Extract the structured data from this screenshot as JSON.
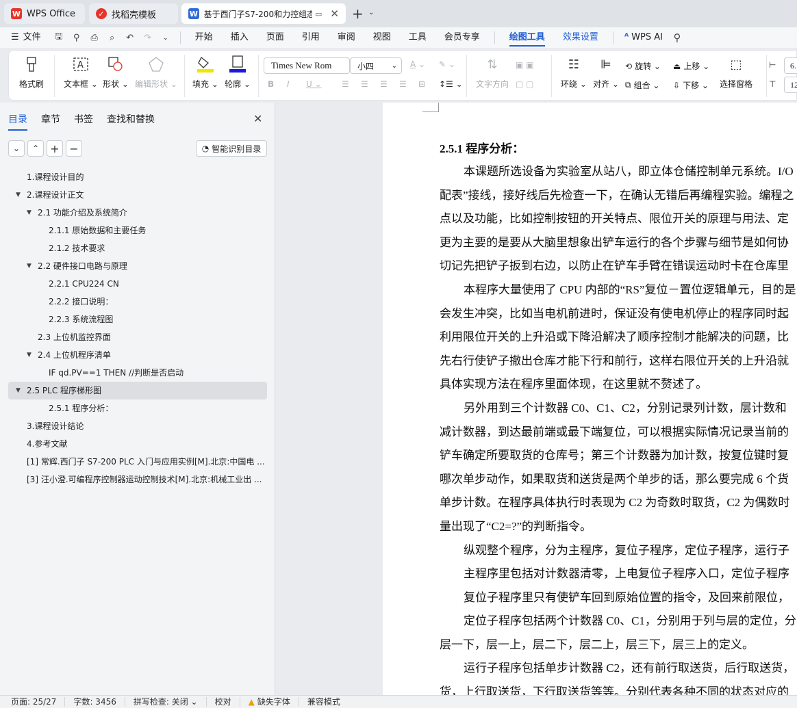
{
  "tabs": [
    {
      "label": "WPS Office"
    },
    {
      "label": "找稻壳模板"
    },
    {
      "label": "基于西门子S7-200和力控组态"
    }
  ],
  "menu": {
    "file": "文件",
    "items": [
      "开始",
      "插入",
      "页面",
      "引用",
      "审阅",
      "视图",
      "工具",
      "会员专享"
    ],
    "drawing_tools": "绘图工具",
    "effect_settings": "效果设置",
    "wps_ai": "WPS AI"
  },
  "ribbon": {
    "format_painter": "格式刷",
    "textbox": "文本框",
    "shape": "形状",
    "edit_shape": "编辑形状",
    "fill": "填充",
    "outline": "轮廓",
    "font_name": "Times New Rom",
    "font_size": "小四",
    "text_direction": "文字方向",
    "wrap": "环绕",
    "align": "对齐",
    "rotate": "旋转",
    "group": "组合",
    "bring_forward": "上移",
    "send_backward": "下移",
    "selection_pane": "选择窗格",
    "width_value": "6.",
    "height_value": "12"
  },
  "nav": {
    "tabs": [
      "目录",
      "章节",
      "书签",
      "查找和替换"
    ],
    "smart_toc": "智能识别目录",
    "toc": [
      {
        "text": "1.课程设计目的",
        "level": 1,
        "arrow": ""
      },
      {
        "text": "2.课程设计正文",
        "level": 1,
        "arrow": "▼"
      },
      {
        "text": "2.1 功能介绍及系统简介",
        "level": 2,
        "arrow": "▼"
      },
      {
        "text": "2.1.1 原始数据和主要任务",
        "level": 3,
        "arrow": ""
      },
      {
        "text": "2.1.2 技术要求",
        "level": 3,
        "arrow": ""
      },
      {
        "text": "2.2 硬件接口电路与原理",
        "level": 2,
        "arrow": "▼"
      },
      {
        "text": "2.2.1 CPU224 CN",
        "level": 3,
        "arrow": ""
      },
      {
        "text": "2.2.2 接口说明：",
        "level": 3,
        "arrow": ""
      },
      {
        "text": "2.2.3 系统流程图",
        "level": 3,
        "arrow": ""
      },
      {
        "text": "2.3 上位机监控界面",
        "level": 2,
        "arrow": ""
      },
      {
        "text": "2.4 上位机程序清单",
        "level": 2,
        "arrow": "▼"
      },
      {
        "text": "IF qd.PV==1 THEN          //判断是否启动",
        "level": 3,
        "arrow": ""
      },
      {
        "text": "2.5 PLC 程序梯形图",
        "level": 1,
        "arrow": "▼",
        "highlight": true
      },
      {
        "text": "2.5.1 程序分析：",
        "level": 3,
        "arrow": ""
      },
      {
        "text": "3.课程设计结论",
        "level": 1,
        "arrow": ""
      },
      {
        "text": "4.参考文献",
        "level": 1,
        "arrow": ""
      },
      {
        "text": "[1]  常辉.西门子 S7-200 PLC 入门与应用实例[M].北京:中国电 ...",
        "level": 1,
        "arrow": ""
      },
      {
        "text": "[3]  汪小澄.可编程序控制器运动控制技术[M].北京:机械工业出 ...",
        "level": 1,
        "arrow": ""
      }
    ]
  },
  "document": {
    "heading": "2.5.1 程序分析：",
    "lines": [
      {
        "text": "本课题所选设备为实验室从站八，即立体仓储控制单元系统。I/O",
        "indent": true
      },
      {
        "text": "配表”接线，接好线后先检查一下，在确认无错后再编程实验。编程之",
        "indent": false
      },
      {
        "text": "点以及功能，比如控制按钮的开关特点、限位开关的原理与用法、定",
        "indent": false
      },
      {
        "text": "更为主要的是要从大脑里想象出铲车运行的各个步骤与细节是如何协",
        "indent": false
      },
      {
        "text": "切记先把铲子扳到右边，以防止在铲车手臂在错误运动时卡在仓库里",
        "indent": false
      },
      {
        "text": "本程序大量使用了 CPU 内部的“RS”复位－置位逻辑单元，目的是",
        "indent": true
      },
      {
        "text": "会发生冲突，比如当电机前进时，保证没有使电机停止的程序同时起",
        "indent": false
      },
      {
        "text": "利用限位开关的上升沿或下降沿解决了顺序控制才能解决的问题，比",
        "indent": false
      },
      {
        "text": "先右行使铲子撤出仓库才能下行和前行，这样右限位开关的上升沿就",
        "indent": false
      },
      {
        "text": "具体实现方法在程序里面体现，在这里就不赘述了。",
        "indent": false
      },
      {
        "text": "另外用到三个计数器 C0、C1、C2，分别记录列计数，层计数和",
        "indent": true
      },
      {
        "text": "减计数器，到达最前端或最下端复位，可以根据实际情况记录当前的",
        "indent": false
      },
      {
        "text": "铲车确定所要取货的仓库号；第三个计数器为加计数，按复位键时复",
        "indent": false
      },
      {
        "text": "哪次单步动作，如果取货和送货是两个单步的话，那么要完成 6 个货",
        "indent": false
      },
      {
        "text": "单步计数。在程序具体执行时表现为 C2 为奇数时取货，C2 为偶数时",
        "indent": false
      },
      {
        "text": "量出现了“C2=?”的判断指令。",
        "indent": false
      },
      {
        "text": "纵观整个程序，分为主程序，复位子程序，定位子程序，运行子",
        "indent": true
      },
      {
        "text": "主程序里包括对计数器清零，上电复位子程序入口，定位子程序",
        "indent": true
      },
      {
        "text": "复位子程序里只有使铲车回到原始位置的指令，及回来前限位，",
        "indent": true
      },
      {
        "text": "定位子程序包括两个计数器 C0、C1，分别用于列与层的定位，分",
        "indent": true
      },
      {
        "text": "层一下，层一上，层二下，层二上，层三下，层三上的定义。",
        "indent": false
      },
      {
        "text": "运行子程序包括单步计数器 C2，还有前行取送货，后行取送货，",
        "indent": true
      },
      {
        "text": "货，上行取送货，下行取送货等等。分别代表各种不同的状态对应的",
        "indent": false
      }
    ]
  },
  "status": {
    "page": "页面: 25/27",
    "words": "字数: 3456",
    "spell": "拼写检查: 关闭",
    "proof": "校对",
    "missing_font": "缺失字体",
    "compat": "兼容模式"
  },
  "colors": {
    "accent": "#1f5fd1",
    "fill_swatch": "#f2e600",
    "outline_swatch": "#1a1adb",
    "wps_red": "#e8342a"
  }
}
